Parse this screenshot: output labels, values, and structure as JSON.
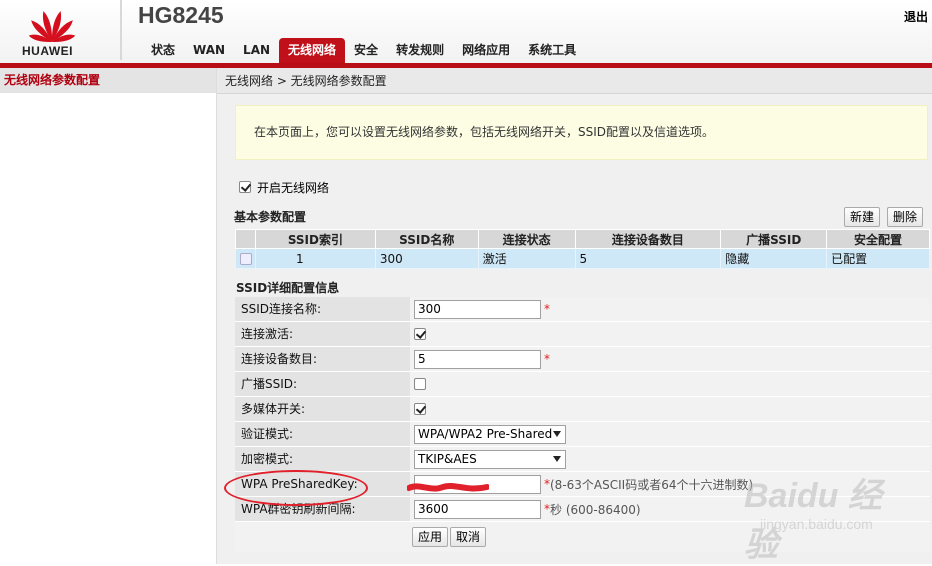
{
  "brand": {
    "logo_text": "HUAWEI",
    "model": "HG8245"
  },
  "header": {
    "logout_label": "退出"
  },
  "nav": {
    "items": [
      {
        "label": "状态"
      },
      {
        "label": "WAN"
      },
      {
        "label": "LAN"
      },
      {
        "label": "无线网络",
        "active": true
      },
      {
        "label": "安全"
      },
      {
        "label": "转发规则"
      },
      {
        "label": "网络应用"
      },
      {
        "label": "系统工具"
      }
    ]
  },
  "sidebar": {
    "items": [
      {
        "label": "无线网络参数配置",
        "active": true
      }
    ]
  },
  "main": {
    "breadcrumb": "无线网络 > 无线网络参数配置",
    "notice": "在本页面上，您可以设置无线网络参数，包括无线网络开关，SSID配置以及信道选项。",
    "enable_wifi": {
      "label": "开启无线网络",
      "checked": true
    },
    "basic": {
      "title": "基本参数配置",
      "new_button": "新建",
      "delete_button": "删除",
      "table": {
        "headers": [
          "SSID索引",
          "SSID名称",
          "连接状态",
          "连接设备数目",
          "广播SSID",
          "安全配置"
        ],
        "rows": [
          [
            "1",
            "300",
            "激活",
            "5",
            "隐藏",
            "已配置"
          ]
        ]
      }
    },
    "detail": {
      "title": "SSID详细配置信息",
      "ssid_name": {
        "label": "SSID连接名称:",
        "value": "300"
      },
      "ssid_active": {
        "label": "连接激活:",
        "checked": true
      },
      "device_count": {
        "label": "连接设备数目:",
        "value": "5"
      },
      "broadcast": {
        "label": "广播SSID:",
        "checked": false
      },
      "multimedia": {
        "label": "多媒体开关:",
        "checked": true
      },
      "auth_mode": {
        "label": "验证模式:",
        "value": "WPA/WPA2 Pre-Shared"
      },
      "encrypt_mode": {
        "label": "加密模式:",
        "value": "TKIP&AES"
      },
      "psk": {
        "label": "WPA PreSharedKey:",
        "hint": "(8-63个ASCII码或者64个十六进制数)"
      },
      "rekey": {
        "label": "WPA群密钥刷新间隔:",
        "value": "3600",
        "hint": "秒 (600-86400)"
      },
      "required_mark": "*",
      "apply_button": "应用",
      "cancel_button": "取消"
    }
  },
  "watermark": {
    "brand": "Baidu 经验",
    "url": "jingyan.baidu.com"
  },
  "colors": {
    "accent": "#c0101a",
    "notice_bg": "#fdfde4",
    "row_selected": "#cfe8f7"
  }
}
